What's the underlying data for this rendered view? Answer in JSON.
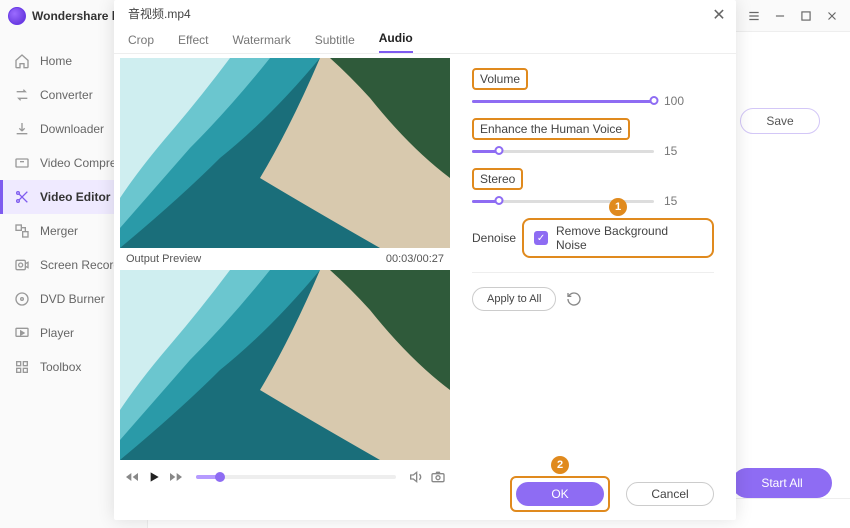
{
  "app": {
    "name": "Wondershare l"
  },
  "sidebar": {
    "items": [
      {
        "label": "Home"
      },
      {
        "label": "Converter"
      },
      {
        "label": "Downloader"
      },
      {
        "label": "Video Compres"
      },
      {
        "label": "Video Editor"
      },
      {
        "label": "Merger"
      },
      {
        "label": "Screen Recorde"
      },
      {
        "label": "DVD Burner"
      },
      {
        "label": "Player"
      },
      {
        "label": "Toolbox"
      }
    ]
  },
  "main": {
    "save_label": "Save",
    "start_all_label": "Start All"
  },
  "modal": {
    "filename": "音视频.mp4",
    "tabs": [
      "Crop",
      "Effect",
      "Watermark",
      "Subtitle",
      "Audio"
    ],
    "preview_label": "Output Preview",
    "time": "00:03/00:27",
    "volume": {
      "label": "Volume",
      "value": 100,
      "pct": 100
    },
    "enhance": {
      "label": "Enhance the Human Voice",
      "value": 15,
      "pct": 15
    },
    "stereo": {
      "label": "Stereo",
      "value": 15,
      "pct": 15
    },
    "denoise_label": "Denoise",
    "denoise_option": "Remove Background Noise",
    "apply_label": "Apply to All",
    "ok_label": "OK",
    "cancel_label": "Cancel"
  }
}
